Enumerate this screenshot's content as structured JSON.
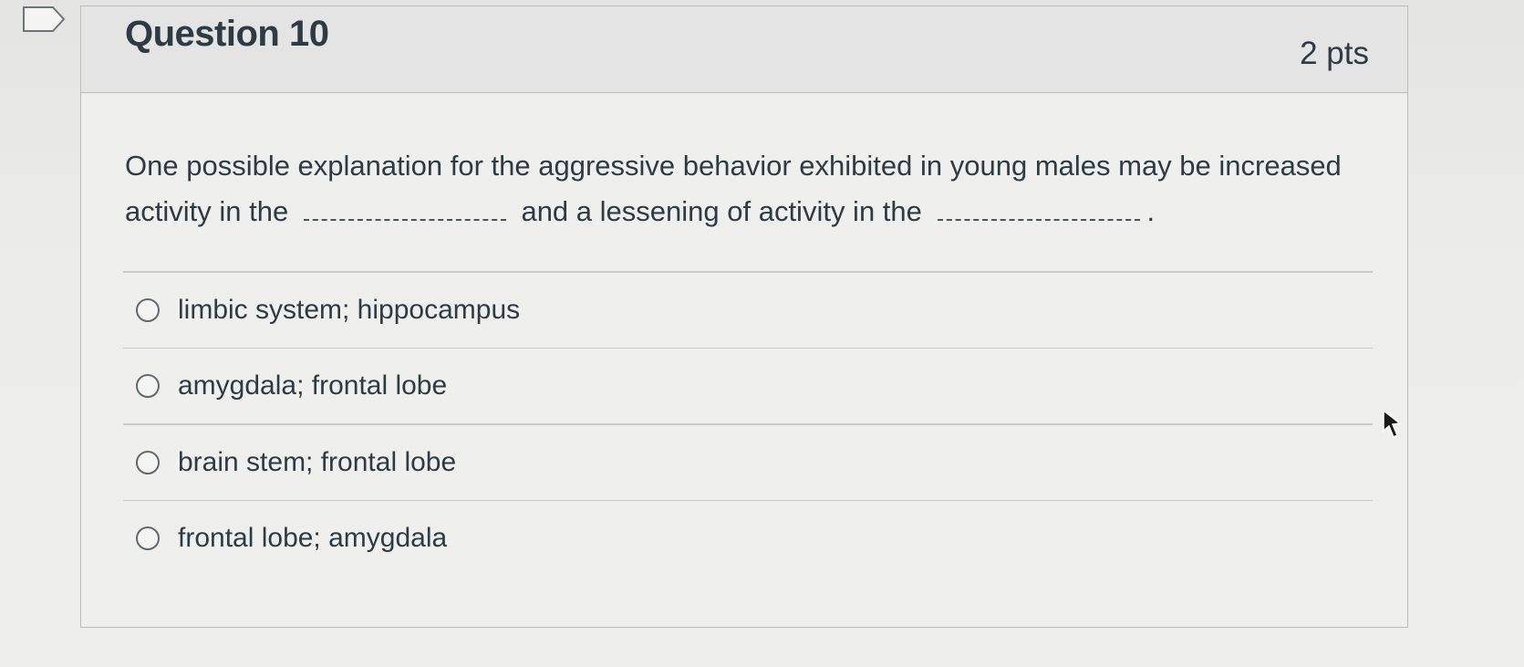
{
  "question": {
    "title": "Question 10",
    "points": "2 pts",
    "text_part1": "One possible explanation for the aggressive behavior exhibited in young males may be increased activity in the",
    "text_part2": "and a lessening of activity in the",
    "text_end": "."
  },
  "answers": [
    {
      "label": "limbic system; hippocampus",
      "selected": false
    },
    {
      "label": "amygdala; frontal lobe",
      "selected": false
    },
    {
      "label": "brain stem; frontal lobe",
      "selected": false
    },
    {
      "label": "frontal lobe; amygdala",
      "selected": false
    }
  ],
  "icons": {
    "bookmark": "bookmark-icon",
    "cursor": "mouse-pointer-icon"
  },
  "colors": {
    "text": "#2d3b45",
    "border": "#b8bcbe",
    "header_bg": "#e3e4e3"
  }
}
